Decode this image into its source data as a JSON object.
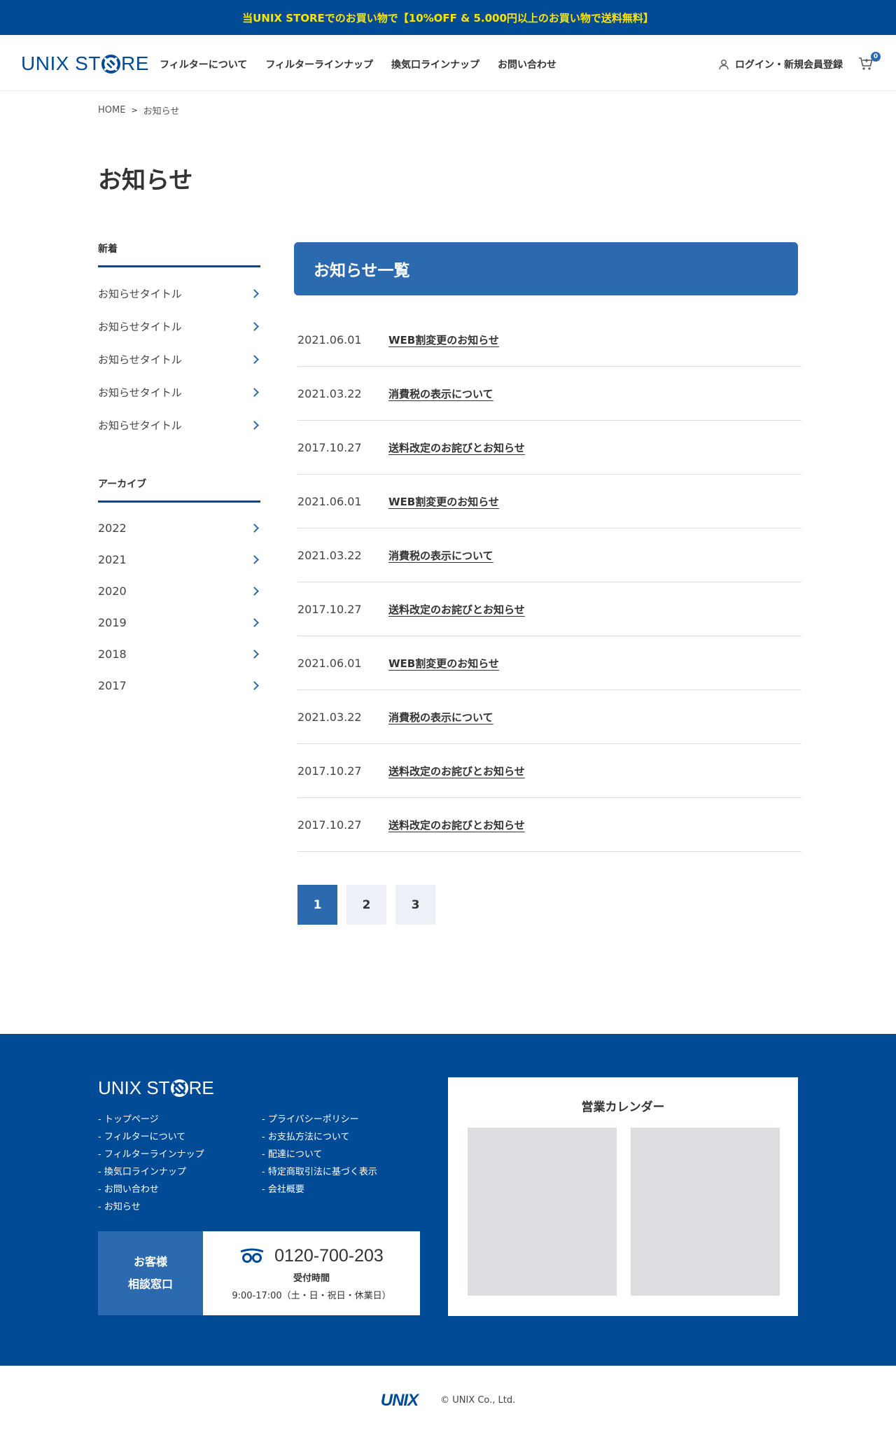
{
  "banner": {
    "text": "当UNIX STOREでのお買い物で【10%OFF & 5.000円以上のお買い物で送料無料】"
  },
  "header": {
    "logo_pre": "UNIX ST",
    "logo_post": "RE",
    "nav": [
      "フィルターについて",
      "フィルターラインナップ",
      "換気口ラインナップ",
      "お問い合わせ"
    ],
    "login_label": "ログイン・新規会員登録",
    "cart_count": "0"
  },
  "breadcrumb": {
    "home": "HOME",
    "separator": ">",
    "current": "お知らせ"
  },
  "page_title": "お知らせ",
  "sidebar": {
    "recent_title": "新着",
    "recent_items": [
      "お知らせタイトル",
      "お知らせタイトル",
      "お知らせタイトル",
      "お知らせタイトル",
      "お知らせタイトル"
    ],
    "archive_title": "アーカイブ",
    "archive_items": [
      "2022",
      "2021",
      "2020",
      "2019",
      "2018",
      "2017"
    ]
  },
  "news": {
    "heading": "お知らせ一覧",
    "items": [
      {
        "date": "2021.06.01",
        "title": "WEB割変更のお知らせ"
      },
      {
        "date": "2021.03.22",
        "title": "消費税の表示について"
      },
      {
        "date": "2017.10.27",
        "title": "送料改定のお詫びとお知らせ"
      },
      {
        "date": "2021.06.01",
        "title": "WEB割変更のお知らせ"
      },
      {
        "date": "2021.03.22",
        "title": "消費税の表示について"
      },
      {
        "date": "2017.10.27",
        "title": "送料改定のお詫びとお知らせ"
      },
      {
        "date": "2021.06.01",
        "title": "WEB割変更のお知らせ"
      },
      {
        "date": "2021.03.22",
        "title": "消費税の表示について"
      },
      {
        "date": "2017.10.27",
        "title": "送料改定のお詫びとお知らせ"
      },
      {
        "date": "2017.10.27",
        "title": "送料改定のお詫びとお知らせ"
      }
    ]
  },
  "pagination": {
    "pages": [
      "1",
      "2",
      "3"
    ],
    "current": "1"
  },
  "footer": {
    "logo_pre": "UNIX ST",
    "logo_post": "RE",
    "links_col1": [
      "- トップページ",
      "- フィルターについて",
      "- フィルターラインナップ",
      "- 換気口ラインナップ",
      "- お問い合わせ",
      "- お知らせ"
    ],
    "links_col2": [
      "- プライバシーポリシー",
      "- お支払方法について",
      "- 配達について",
      "- 特定商取引法に基づく表示",
      "- 会社概要"
    ],
    "contact": {
      "label_line1": "お客様",
      "label_line2": "相談窓口",
      "tel": "0120-700-203",
      "hours_label": "受付時間",
      "hours": "9:00-17:00（土・日・祝日・休業日）"
    },
    "calendar_title": "営業カレンダー"
  },
  "bottom": {
    "brand": "UNIX",
    "copyright": "© UNIX Co., Ltd."
  },
  "colors": {
    "brand_blue": "#004a96",
    "accent_blue": "#2b6aaf",
    "banner_text": "#ffe400"
  }
}
